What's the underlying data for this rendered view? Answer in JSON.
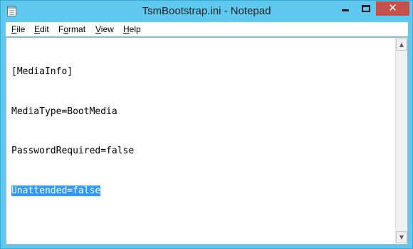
{
  "window": {
    "title": "TsmBootstrap.ini - Notepad",
    "close_glyph": "✕"
  },
  "menu": [
    {
      "label": "File",
      "mnemonic": "F",
      "rest": "ile"
    },
    {
      "label": "Edit",
      "mnemonic": "E",
      "rest": "dit"
    },
    {
      "label": "Format",
      "mnemonic": "o",
      "prefix": "F",
      "rest": "rmat"
    },
    {
      "label": "View",
      "mnemonic": "V",
      "rest": "iew"
    },
    {
      "label": "Help",
      "mnemonic": "H",
      "rest": "elp"
    }
  ],
  "editor": {
    "lines": [
      "[MediaInfo]",
      "MediaType=BootMedia",
      "PasswordRequired=false",
      "Unattended=false"
    ],
    "selected_line_index": 3
  },
  "scrollbar": {
    "up_glyph": "▲",
    "down_glyph": "▼"
  },
  "colors": {
    "title_bar": "#5fc8ee",
    "close_button": "#c7504a",
    "selection": "#3399ff"
  },
  "icons": {
    "app": "notepad-icon",
    "minimize": "minimize-icon",
    "maximize": "maximize-icon",
    "close": "close-icon"
  }
}
